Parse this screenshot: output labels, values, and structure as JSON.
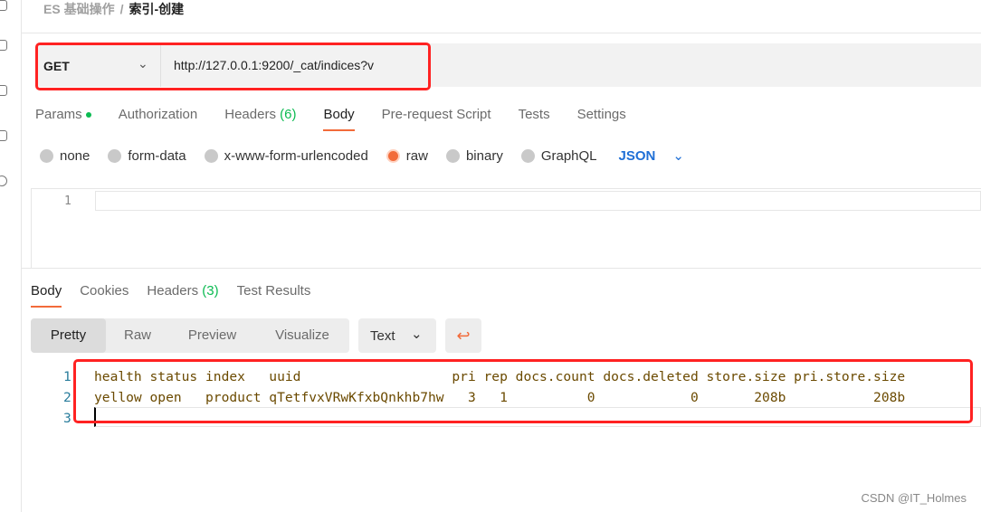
{
  "breadcrumb": {
    "parent": "ES 基础操作",
    "separator": "/",
    "current": "索引-创建"
  },
  "request": {
    "method": "GET",
    "url": "http://127.0.0.1:9200/_cat/indices?v"
  },
  "request_tabs": [
    {
      "label": "Params"
    },
    {
      "label": "Authorization"
    },
    {
      "label": "Headers",
      "count": "(6)"
    },
    {
      "label": "Body"
    },
    {
      "label": "Pre-request Script"
    },
    {
      "label": "Tests"
    },
    {
      "label": "Settings"
    }
  ],
  "body_types": [
    "none",
    "form-data",
    "x-www-form-urlencoded",
    "raw",
    "binary",
    "GraphQL"
  ],
  "body_format": "JSON",
  "editor": {
    "line": "1"
  },
  "response_tabs": [
    {
      "label": "Body"
    },
    {
      "label": "Cookies"
    },
    {
      "label": "Headers",
      "count": "(3)"
    },
    {
      "label": "Test Results"
    }
  ],
  "view_modes": [
    "Pretty",
    "Raw",
    "Preview",
    "Visualize"
  ],
  "response_format": "Text",
  "response_lines": [
    {
      "n": "1",
      "text": "health status index   uuid                   pri rep docs.count docs.deleted store.size pri.store.size"
    },
    {
      "n": "2",
      "text": "yellow open   product qTetfvxVRwKfxbQnkhb7hw   3   1          0            0       208b           208b"
    },
    {
      "n": "3",
      "text": ""
    }
  ],
  "watermark": "CSDN @IT_Holmes",
  "colors": {
    "accent": "#f26b3a",
    "highlight": "#ff2222",
    "link": "#1f6fd6"
  }
}
